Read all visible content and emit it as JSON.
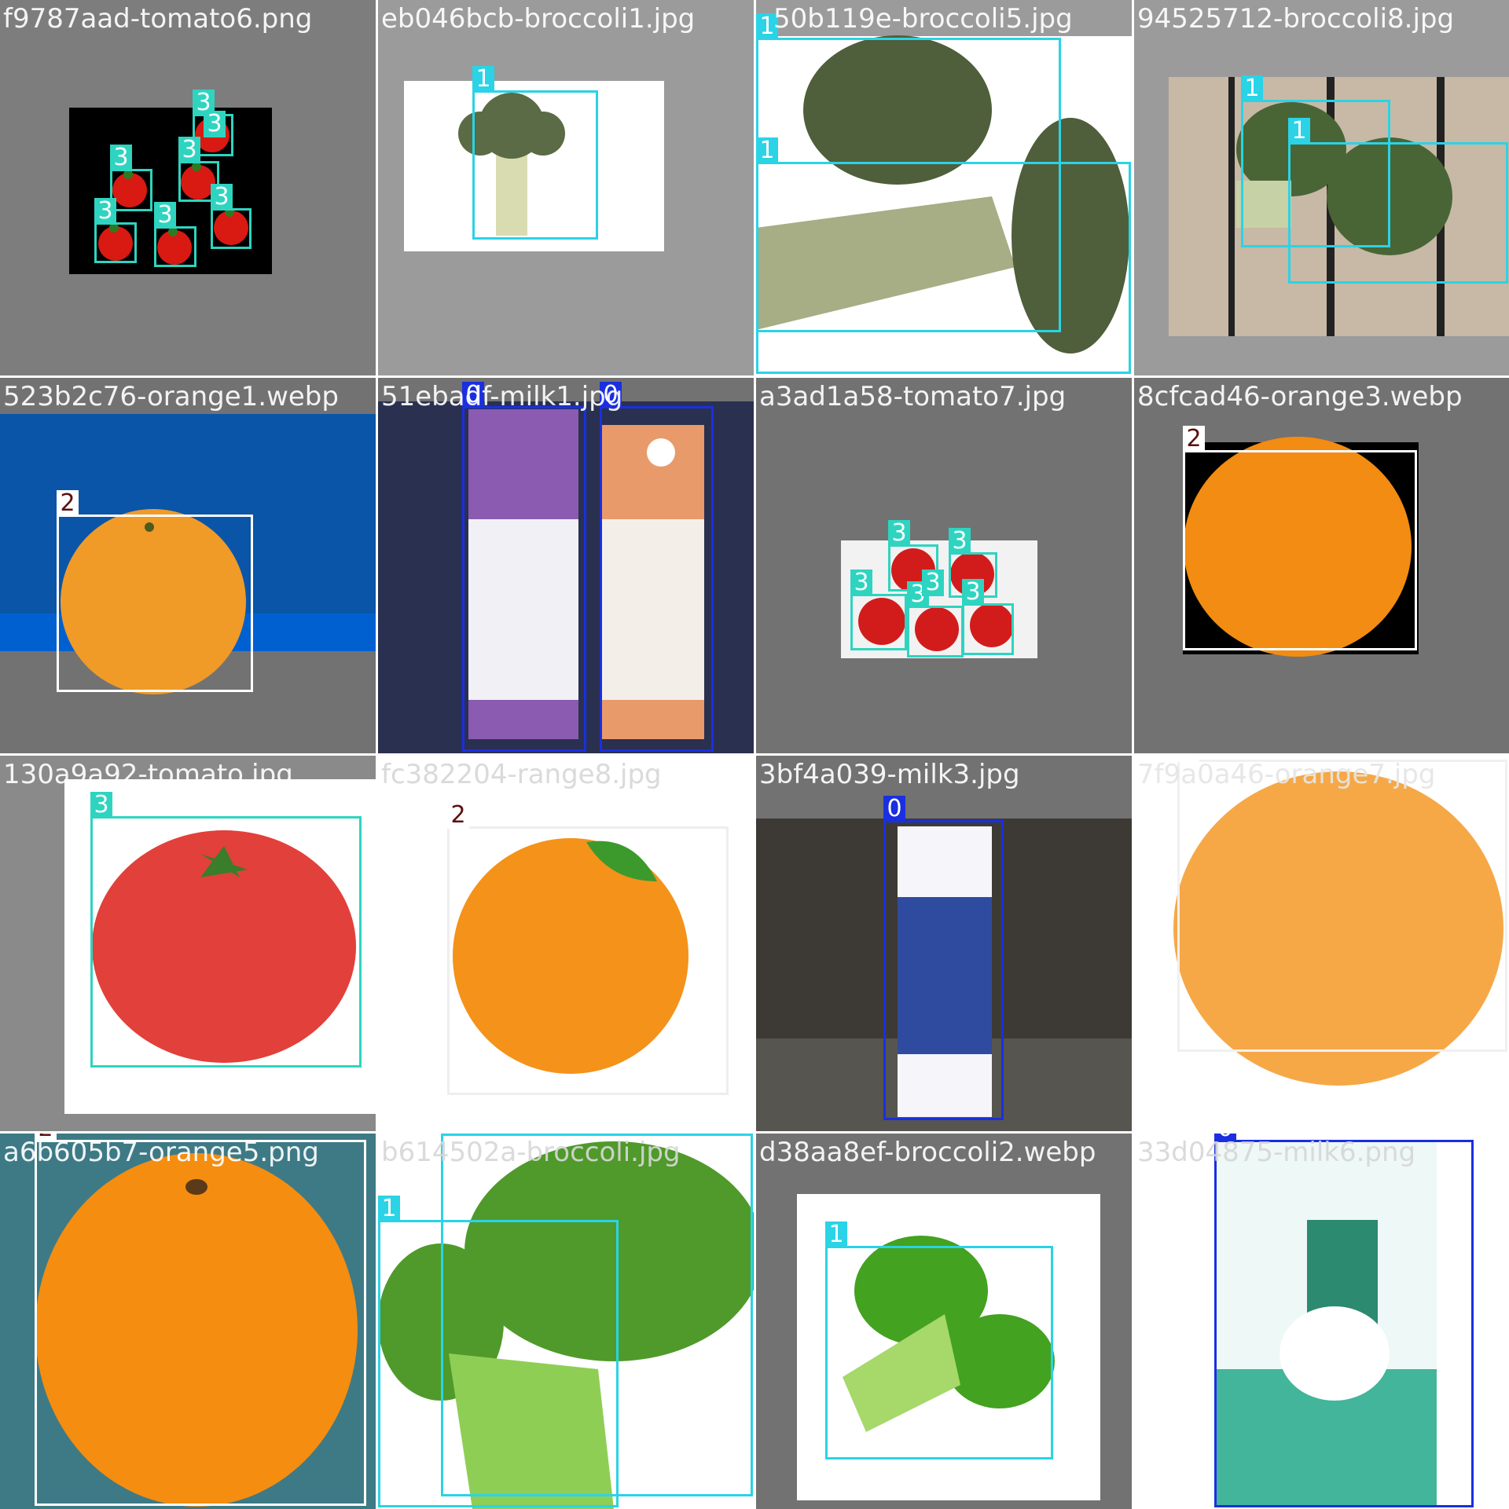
{
  "classes": {
    "0": {
      "label": "0",
      "color": "#1a2fe0"
    },
    "1": {
      "label": "1",
      "color": "#2ad3e6"
    },
    "2": {
      "label": "2",
      "color": "#ffffff"
    },
    "3": {
      "label": "3",
      "color": "#2ed4c0"
    }
  },
  "tiles": [
    {
      "filename": "f9787aad-tomato6.png",
      "boxes": [
        "3",
        "3",
        "3",
        "3",
        "3",
        "3",
        "3"
      ]
    },
    {
      "filename": "eb046bcb-broccoli1.jpg",
      "boxes": [
        "1"
      ]
    },
    {
      "filename": "50b119e-broccoli5.jpg",
      "boxes": [
        "1",
        "1"
      ]
    },
    {
      "filename": "94525712-broccoli8.jpg",
      "boxes": [
        "1",
        "1"
      ]
    },
    {
      "filename": "523b2c76-orange1.webp",
      "boxes": [
        "2"
      ]
    },
    {
      "filename": "51ebadf-milk1.jpg",
      "boxes": [
        "0",
        "0"
      ]
    },
    {
      "filename": "a3ad1a58-tomato7.jpg",
      "boxes": [
        "3",
        "3",
        "3",
        "3",
        "3",
        "3"
      ]
    },
    {
      "filename": "8cfcad46-orange3.webp",
      "boxes": [
        "2"
      ]
    },
    {
      "filename": "130a9a92-tomato.jpg",
      "boxes": [
        "3"
      ]
    },
    {
      "filename": "fc382204-range8.jpg",
      "boxes": [
        "2"
      ]
    },
    {
      "filename": "3bf4a039-milk3.jpg",
      "boxes": [
        "0"
      ]
    },
    {
      "filename": "7f9a0a46-orange7.jpg",
      "boxes": [
        "2"
      ]
    },
    {
      "filename": "a6b605b7-orange5.png",
      "boxes": [
        "2"
      ]
    },
    {
      "filename": "b614502a-broccoli.jpg",
      "boxes": [
        "1",
        "1"
      ]
    },
    {
      "filename": "d38aa8ef-broccoli2.webp",
      "boxes": [
        "1"
      ]
    },
    {
      "filename": "33d04875-milk6.png",
      "boxes": [
        "0"
      ]
    }
  ]
}
